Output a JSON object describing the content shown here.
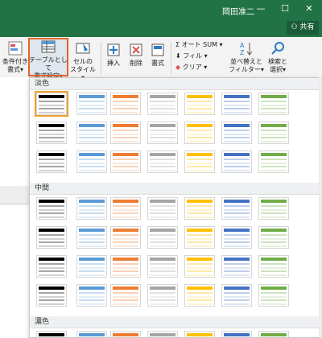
{
  "titlebar": {
    "user": "岡田准二",
    "restore_label": "⧉",
    "minimize_label": "—",
    "maximize_label": "☐",
    "close_label": "✕",
    "share_label": "共有"
  },
  "ribbon": {
    "conditional_format": [
      "条件付き",
      "書式▾"
    ],
    "format_as_table": [
      "テーブルとして",
      "書式設定▾"
    ],
    "cell_style": [
      "セルの",
      "スタイル▾"
    ],
    "insert": "挿入",
    "delete": "削除",
    "format": "書式",
    "autosum": "Σ オート SUM ▾",
    "fill": "フィル ▾",
    "clear": "クリア ▾",
    "sort_filter": [
      "並べ替えと",
      "フィルター▾"
    ],
    "find_select": [
      "検索と",
      "選択▾"
    ]
  },
  "gallery": {
    "sections": [
      {
        "label": "淡色",
        "rows": 3
      },
      {
        "label": "中間",
        "rows": 4
      },
      {
        "label": "濃色",
        "rows": 1
      }
    ],
    "row_styles": [
      [
        "#000000",
        "#5b9bd5",
        "#ed7d31",
        "#a5a5a5",
        "#ffc000",
        "#4472c4",
        "#70ad47"
      ],
      [
        "#000000",
        "#5b9bd5",
        "#ed7d31",
        "#a5a5a5",
        "#ffc000",
        "#4472c4",
        "#70ad47"
      ],
      [
        "#000000",
        "#5b9bd5",
        "#ed7d31",
        "#a5a5a5",
        "#ffc000",
        "#4472c4",
        "#70ad47"
      ],
      [
        "#000000",
        "#5b9bd5",
        "#ed7d31",
        "#a5a5a5",
        "#ffc000",
        "#4472c4",
        "#70ad47"
      ],
      [
        "#000000",
        "#5b9bd5",
        "#ed7d31",
        "#a5a5a5",
        "#ffc000",
        "#4472c4",
        "#70ad47"
      ],
      [
        "#000000",
        "#5b9bd5",
        "#ed7d31",
        "#a5a5a5",
        "#ffc000",
        "#4472c4",
        "#70ad47"
      ],
      [
        "#000000",
        "#5b9bd5",
        "#ed7d31",
        "#a5a5a5",
        "#ffc000",
        "#4472c4",
        "#70ad47"
      ],
      [
        "#000000",
        "#5b9bd5",
        "#ed7d31",
        "#a5a5a5",
        "#ffc000",
        "#4472c4",
        "#70ad47"
      ]
    ],
    "accent_selected": "#f0a030"
  },
  "colors": {
    "brand": "#217346",
    "highlight": "#e0652a"
  }
}
